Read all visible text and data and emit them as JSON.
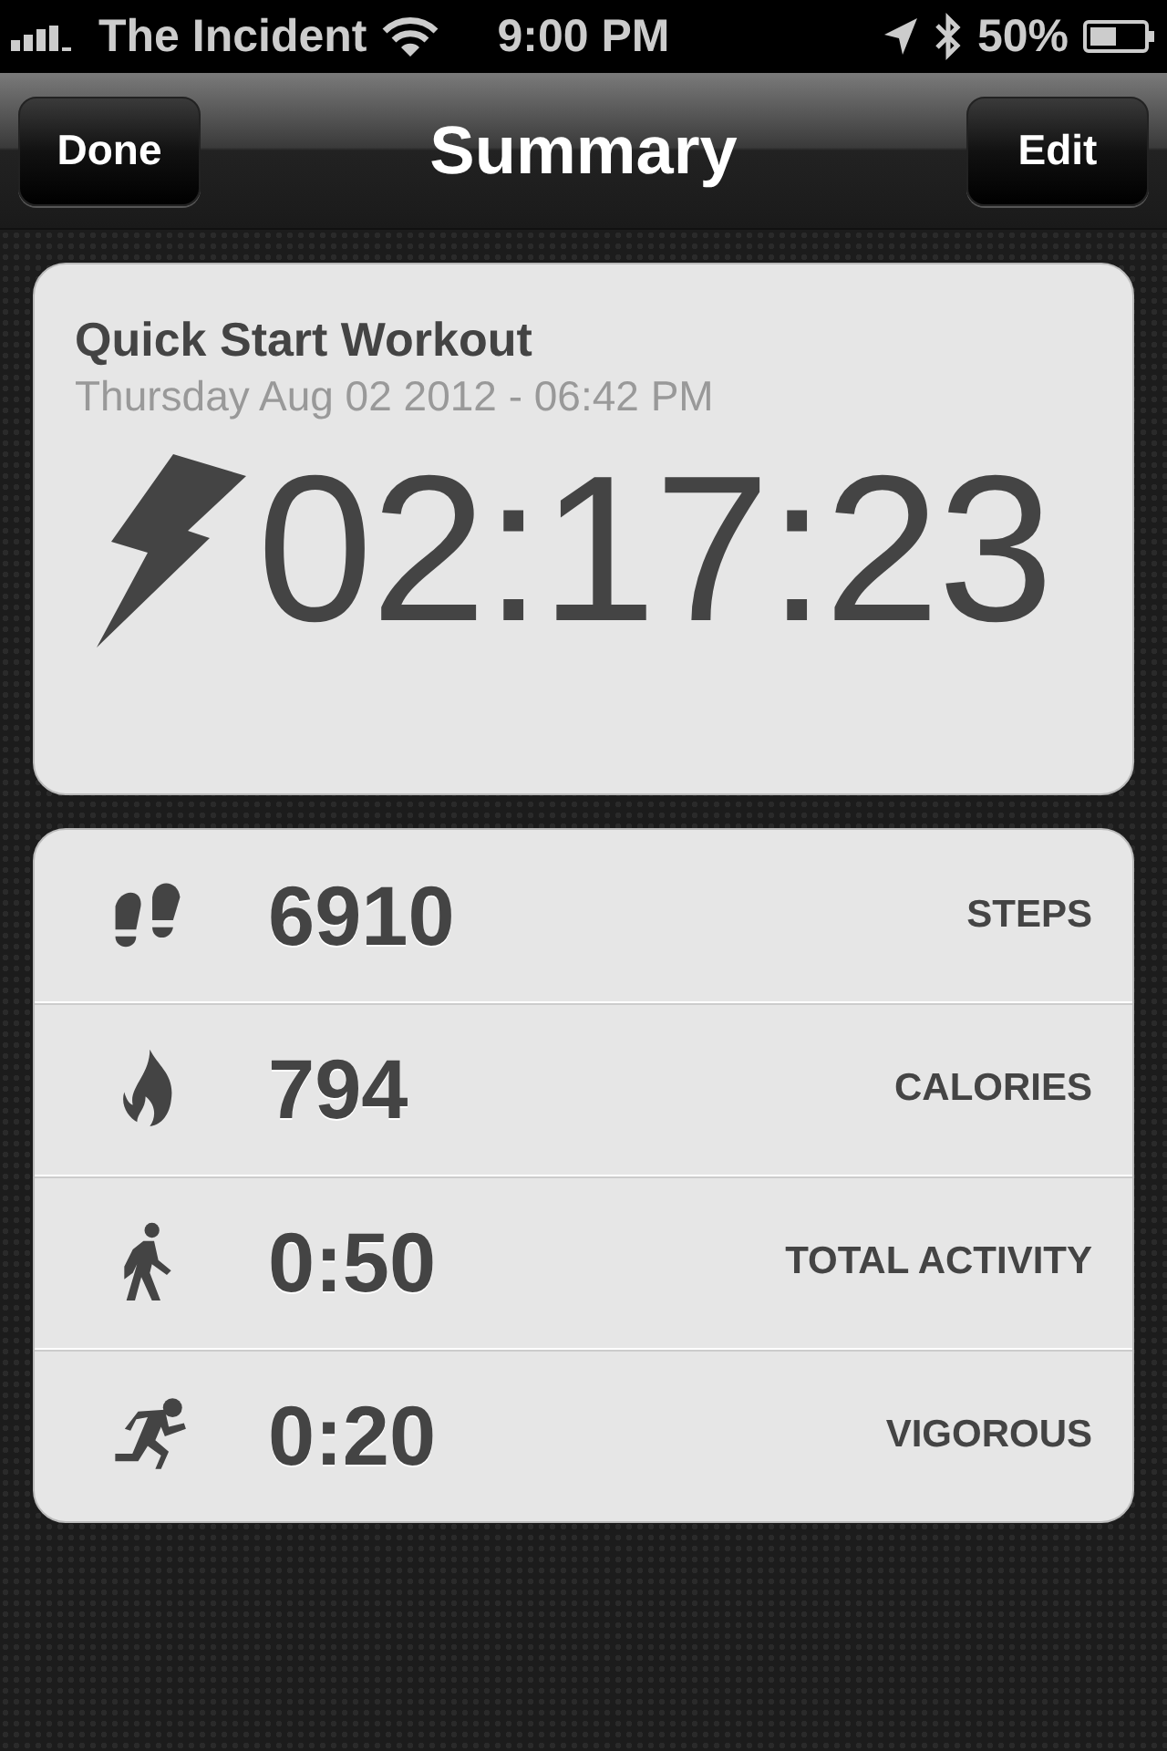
{
  "status_bar": {
    "carrier": "The Incident",
    "time": "9:00 PM",
    "battery": "50%"
  },
  "nav": {
    "title": "Summary",
    "left_button": "Done",
    "right_button": "Edit"
  },
  "workout": {
    "title": "Quick Start Workout",
    "date": "Thursday Aug 02 2012 - 06:42 PM",
    "duration": "02:17:23"
  },
  "stats": [
    {
      "kind": "steps",
      "value": "6910",
      "label": "STEPS"
    },
    {
      "kind": "calories",
      "value": "794",
      "label": "CALORIES"
    },
    {
      "kind": "walk",
      "value": "0:50",
      "label": "TOTAL ACTIVITY"
    },
    {
      "kind": "run",
      "value": "0:20",
      "label": "VIGOROUS"
    }
  ]
}
